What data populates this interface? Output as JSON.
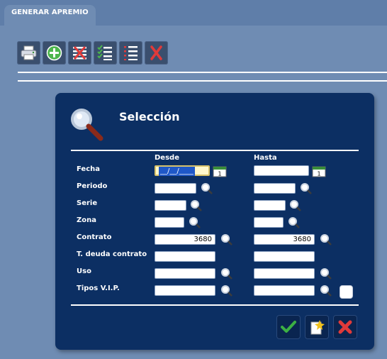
{
  "tab": {
    "label": "GENERAR APREMIO"
  },
  "toolbar": {
    "buttons": [
      {
        "icon": "printer-icon"
      },
      {
        "icon": "add-icon"
      },
      {
        "icon": "delete-list-icon"
      },
      {
        "icon": "checklist-icon"
      },
      {
        "icon": "numbered-list-icon"
      },
      {
        "icon": "close-icon"
      }
    ]
  },
  "dialog": {
    "title": "Selección",
    "columns": {
      "from": "Desde",
      "to": "Hasta"
    },
    "rows": {
      "fecha": {
        "label": "Fecha",
        "from_value": "__/__/____",
        "to_value": ""
      },
      "periodo": {
        "label": "Periodo",
        "from_value": "",
        "to_value": ""
      },
      "serie": {
        "label": "Serie",
        "from_value": "",
        "to_value": ""
      },
      "zona": {
        "label": "Zona",
        "from_value": "",
        "to_value": ""
      },
      "contrato": {
        "label": "Contrato",
        "from_value": "3680",
        "to_value": "3680"
      },
      "tdeuda": {
        "label": "T. deuda contrato",
        "from_value": "",
        "to_value": ""
      },
      "uso": {
        "label": "Uso",
        "from_value": "",
        "to_value": ""
      },
      "tiposvip": {
        "label": "Tipos V.I.P.",
        "from_value": "",
        "to_value": ""
      }
    },
    "actions": [
      {
        "icon": "checkmark-icon"
      },
      {
        "icon": "new-document-icon"
      },
      {
        "icon": "cancel-icon"
      }
    ]
  },
  "colors": {
    "background": "#5f7ea9",
    "dialog": "#0c2f63",
    "accent_red": "#e03a3a",
    "accent_green": "#3cb043"
  }
}
